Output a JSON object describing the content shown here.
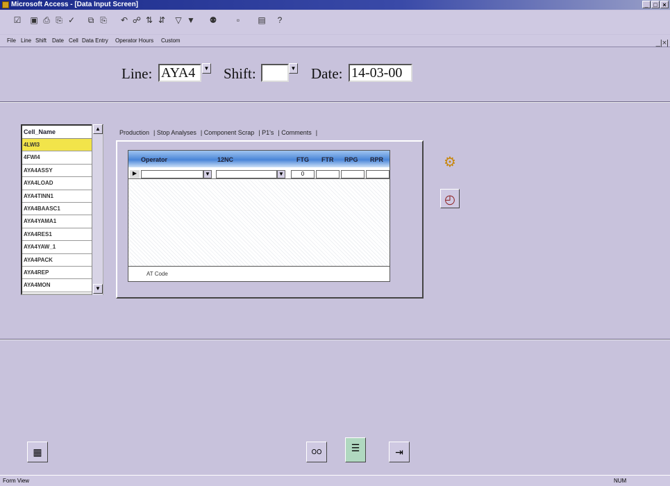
{
  "window": {
    "title": "Microsoft Access - [Data Input Screen]",
    "controls": [
      "_",
      "□",
      "×"
    ],
    "mdi_controls": "_|×|"
  },
  "toolbar": {
    "buttons": [
      {
        "name": "view-icon",
        "glyph": "☑"
      },
      {
        "name": "save-icon",
        "glyph": "▣"
      },
      {
        "name": "print-icon",
        "glyph": "⎙"
      },
      {
        "name": "print-preview-icon",
        "glyph": "⎘"
      },
      {
        "name": "spelling-icon",
        "glyph": "✓"
      },
      {
        "name": "copy-icon",
        "glyph": "⧉"
      },
      {
        "name": "paste-icon",
        "glyph": "⎘"
      },
      {
        "name": "undo-icon",
        "glyph": "↶"
      },
      {
        "name": "hyperlink-icon",
        "glyph": "☍"
      },
      {
        "name": "sort-ascending-icon",
        "glyph": "⇅"
      },
      {
        "name": "sort-descending-icon",
        "glyph": "⇵"
      },
      {
        "name": "filter-icon",
        "glyph": "▽"
      },
      {
        "name": "filter-form-icon",
        "glyph": "▼"
      },
      {
        "name": "find-icon",
        "glyph": "⚉"
      },
      {
        "name": "new-record-icon",
        "glyph": "▫"
      },
      {
        "name": "database-window-icon",
        "glyph": "▤"
      },
      {
        "name": "help-icon",
        "glyph": "?"
      }
    ]
  },
  "menubar": {
    "items": [
      "File",
      "Line",
      "Shift",
      "Date",
      "Cell",
      "Data Entry",
      "Operator Hours",
      "Custom"
    ]
  },
  "header": {
    "line_label": "Line:",
    "line_value": "AYA4",
    "shift_label": "Shift:",
    "shift_value": "",
    "date_label": "Date:",
    "date_value": "14-03-00"
  },
  "cell_list": {
    "header": "Cell_Name",
    "items": [
      "4LWI3",
      "4FWI4",
      "AYA4ASSY",
      "AYA4LOAD",
      "AYA4TINN1",
      "AYA4BAASC1",
      "AYA4YAMA1",
      "AYA4RES1",
      "AYA4YAW_1",
      "AYA4PACK",
      "AYA4REP",
      "AYA4MON"
    ],
    "selected_index": 0
  },
  "tabs": [
    "Production",
    "Stop Analyses",
    "Component Scrap",
    "P1's",
    "Comments"
  ],
  "subform": {
    "columns": [
      "Operator",
      "12NC",
      "FTG",
      "FTR",
      "RPG",
      "RPR"
    ],
    "row": {
      "selector": "▶",
      "ftg_value": "0"
    },
    "footer_label": "AT Code"
  },
  "side_buttons": [
    {
      "name": "report-icon",
      "glyph": "⚙"
    },
    {
      "name": "clock-icon",
      "glyph": "◴"
    }
  ],
  "bottom_buttons": [
    {
      "name": "calendar-icon",
      "glyph": "▦"
    },
    {
      "name": "glasses-icon",
      "glyph": "౦౦"
    },
    {
      "name": "notebook-icon",
      "glyph": "☰"
    },
    {
      "name": "exit-door-icon",
      "glyph": "⇥"
    }
  ],
  "status": {
    "left": "Form View",
    "right": "NUM"
  }
}
